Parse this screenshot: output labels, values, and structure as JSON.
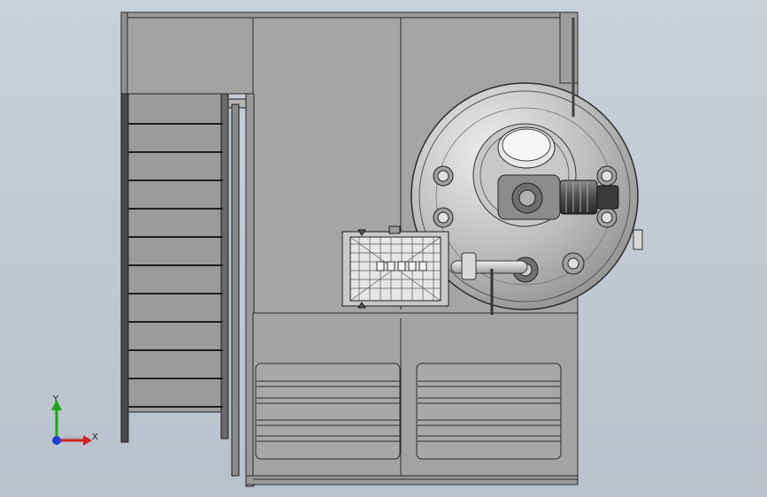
{
  "viewport": {
    "background_top": "#c9d0d8",
    "background_bottom": "#b9c2cc"
  },
  "model": {
    "frame_fill": "#9c9c9c",
    "panel_fill": "#a3a3a3",
    "line_color": "#2b2b2b",
    "vessel_fill": "#b8b8b8",
    "vessel_highlight": "#e6e6e6"
  },
  "triad": {
    "x_label": "X",
    "y_label": "Y",
    "x_color": "#d12020",
    "y_color": "#1fa31f",
    "z_color": "#1f3fd1"
  }
}
